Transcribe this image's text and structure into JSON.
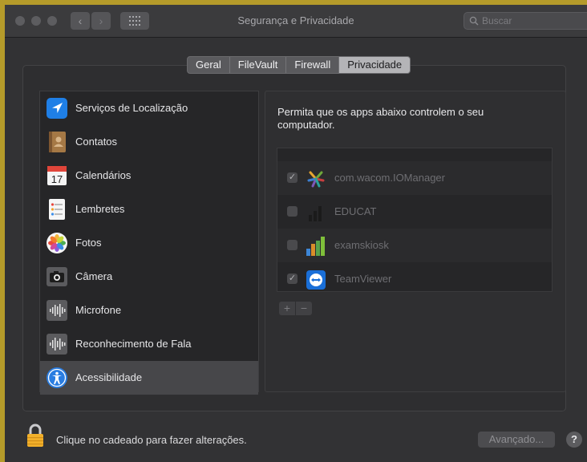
{
  "window": {
    "title": "Segurança e Privacidade",
    "search_placeholder": "Buscar",
    "nav_back": "‹",
    "nav_forward": "›"
  },
  "tabs": [
    {
      "label": "Geral",
      "active": false
    },
    {
      "label": "FileVault",
      "active": false
    },
    {
      "label": "Firewall",
      "active": false
    },
    {
      "label": "Privacidade",
      "active": true
    }
  ],
  "sidebar": {
    "items": [
      {
        "label": "Serviços de Localização",
        "icon": "location-arrow-icon"
      },
      {
        "label": "Contatos",
        "icon": "contacts-book-icon"
      },
      {
        "label": "Calendários",
        "icon": "calendar-icon",
        "icon_text": "17"
      },
      {
        "label": "Lembretes",
        "icon": "reminders-icon"
      },
      {
        "label": "Fotos",
        "icon": "photos-flower-icon"
      },
      {
        "label": "Câmera",
        "icon": "camera-icon"
      },
      {
        "label": "Microfone",
        "icon": "microphone-waveform-icon"
      },
      {
        "label": "Reconhecimento de Fala",
        "icon": "speech-waveform-icon"
      },
      {
        "label": "Acessibilidade",
        "icon": "accessibility-icon",
        "selected": true
      }
    ]
  },
  "panel": {
    "description": "Permita que os apps abaixo controlem o seu computador.",
    "apps": [
      {
        "label": "com.wacom.IOManager",
        "checked": true,
        "icon": "wacom-icon"
      },
      {
        "label": "EDUCAT",
        "checked": false,
        "icon": "educat-bars-icon"
      },
      {
        "label": "examskiosk",
        "checked": false,
        "icon": "examskiosk-bars-icon"
      },
      {
        "label": "TeamViewer",
        "checked": true,
        "icon": "teamviewer-icon"
      }
    ],
    "add_label": "+",
    "remove_label": "−",
    "check_mark": "✓"
  },
  "footer": {
    "lock_text": "Clique no cadeado para fazer alterações.",
    "advanced_label": "Avançado...",
    "help_label": "?"
  },
  "colors": {
    "accent_selected_tab": "#b4b4b7",
    "window_bg": "#323234",
    "outer_border": "#b59b2a"
  }
}
